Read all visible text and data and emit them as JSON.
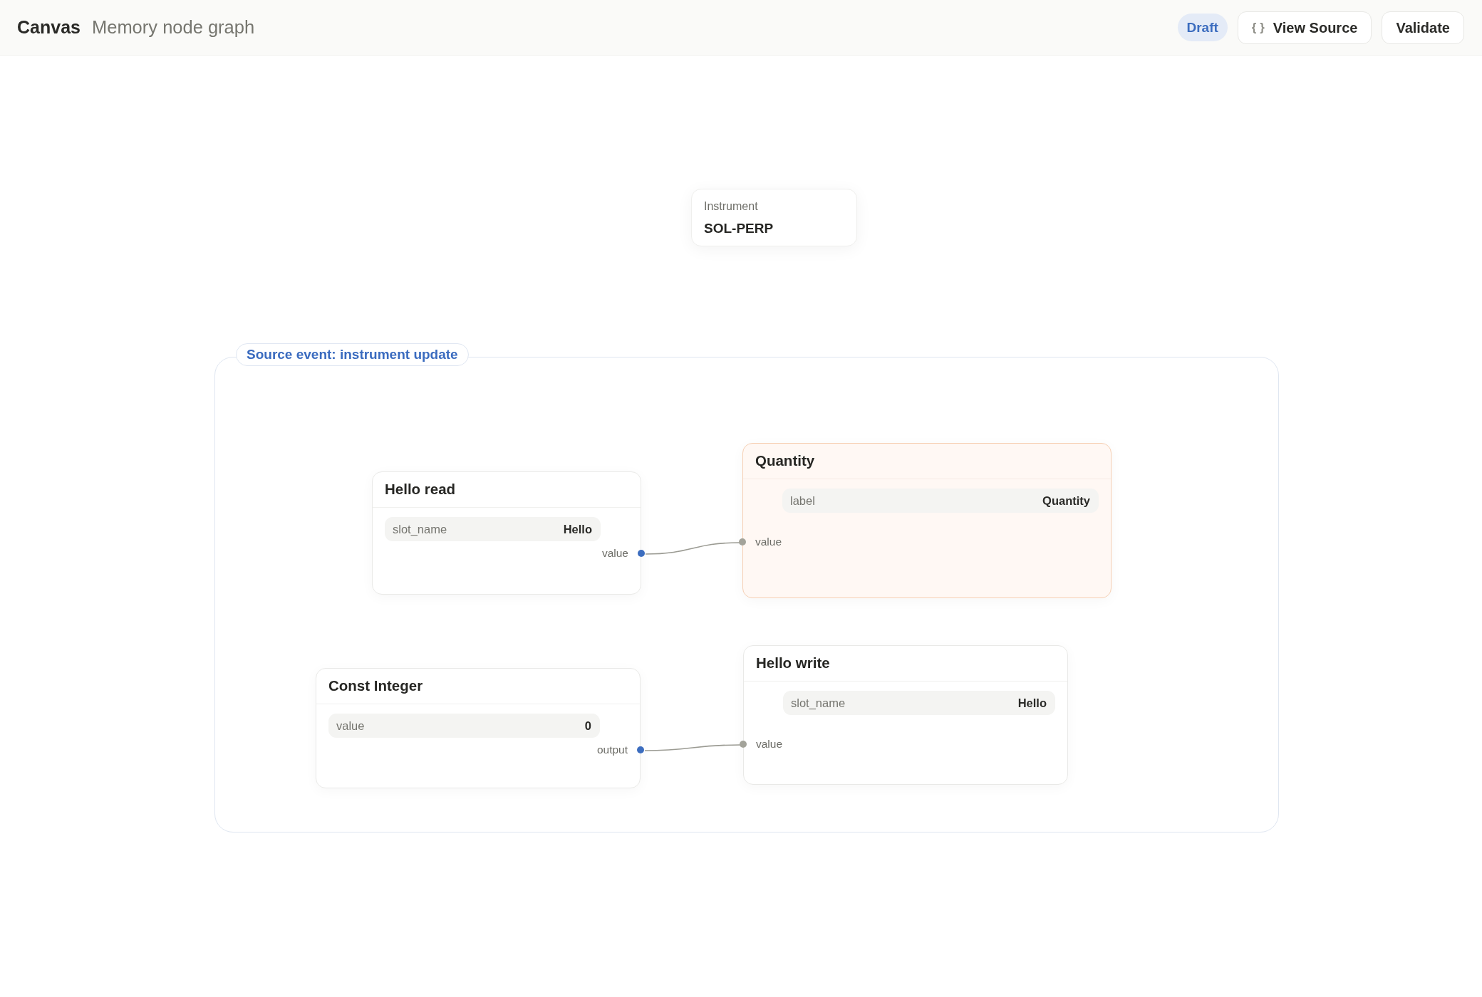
{
  "header": {
    "title": "Canvas",
    "subtitle": "Memory node graph",
    "status": "Draft",
    "buttons": [
      {
        "icon": "{ }",
        "label": "View Source"
      },
      {
        "label": "Validate"
      }
    ]
  },
  "canvas": {
    "value_nodes": [
      {
        "label": "Instrument",
        "value": "SOL-PERP"
      }
    ],
    "group": {
      "label": "Source event: instrument update",
      "nodes": [
        {
          "title": "Hello read",
          "selected": false,
          "params": [
            {
              "name": "slot_name",
              "value": "Hello"
            }
          ],
          "outputs": [
            {
              "label": "value",
              "connected": true
            }
          ]
        },
        {
          "title": "Quantity",
          "selected": true,
          "params": [
            {
              "name": "label",
              "value": "Quantity"
            }
          ],
          "inputs": [
            {
              "label": "value",
              "connected": true
            }
          ]
        },
        {
          "title": "Const Integer",
          "selected": false,
          "params": [
            {
              "name": "value",
              "value": "0"
            }
          ],
          "outputs": [
            {
              "label": "output",
              "connected": true
            }
          ]
        },
        {
          "title": "Hello write",
          "selected": false,
          "params": [
            {
              "name": "slot_name",
              "value": "Hello"
            }
          ],
          "inputs": [
            {
              "label": "value",
              "connected": true
            }
          ]
        }
      ]
    }
  }
}
